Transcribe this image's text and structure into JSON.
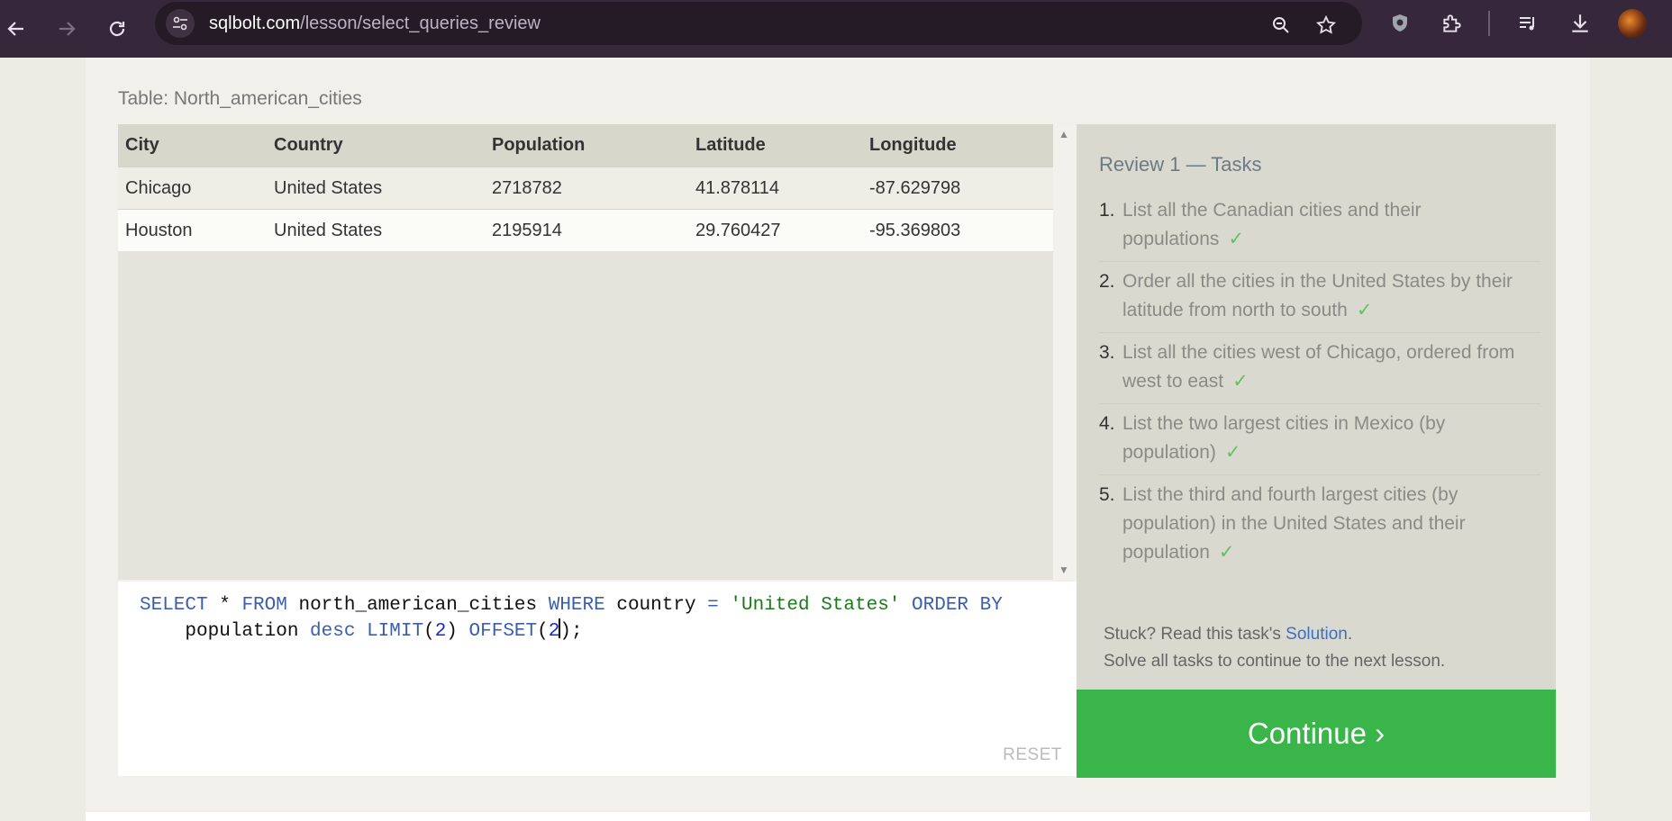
{
  "browser": {
    "url_host": "sqlbolt.com",
    "url_path": "/lesson/select_queries_review"
  },
  "table": {
    "caption": "Table: North_american_cities",
    "columns": [
      "City",
      "Country",
      "Population",
      "Latitude",
      "Longitude"
    ],
    "rows": [
      [
        "Chicago",
        "United States",
        "2718782",
        "41.878114",
        "-87.629798"
      ],
      [
        "Houston",
        "United States",
        "2195914",
        "29.760427",
        "-95.369803"
      ]
    ]
  },
  "editor": {
    "line1": {
      "kw_select": "SELECT",
      "t1": " * ",
      "kw_from": "FROM",
      "t2": " north_american_cities ",
      "kw_where": "WHERE",
      "t3": " country ",
      "op_eq": "=",
      "t4": " ",
      "str_val": "'United States'",
      "t5": " ",
      "kw_order": "ORDER BY"
    },
    "line2": {
      "indent": "    population ",
      "kw_desc": "desc",
      "t1": " ",
      "kw_limit": "LIMIT",
      "p1": "(",
      "n1": "2",
      "p2": ") ",
      "kw_offset": "OFFSET",
      "p3": "(",
      "n2": "2",
      "p4": ");"
    },
    "reset_label": "RESET"
  },
  "tasks": {
    "title": "Review 1 — Tasks",
    "check": "✓",
    "items": [
      {
        "num": "1.",
        "text": "List all the Canadian cities and their populations"
      },
      {
        "num": "2.",
        "text": "Order all the cities in the United States by their latitude from north to south"
      },
      {
        "num": "3.",
        "text": "List all the cities west of Chicago, ordered from west to east"
      },
      {
        "num": "4.",
        "text": "List the two largest cities in Mexico (by population)"
      },
      {
        "num": "5.",
        "text": "List the third and fourth largest cities (by population) in the United States and their population"
      }
    ],
    "stuck_prefix": "Stuck? Read this task's ",
    "solution_link": "Solution",
    "stuck_suffix": ".",
    "solve_all": "Solve all tasks to continue to the next lesson."
  },
  "continue_label": "Continue ›"
}
